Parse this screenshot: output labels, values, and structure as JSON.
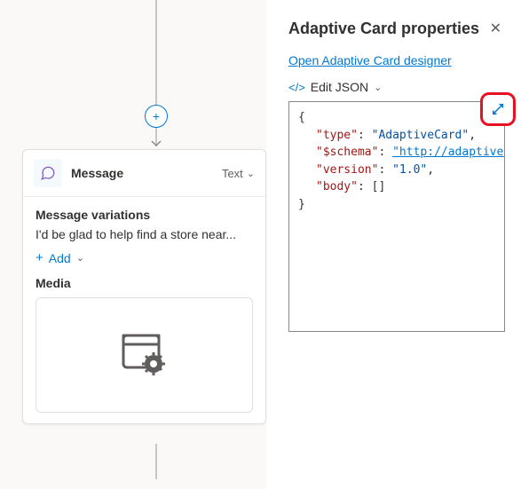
{
  "canvas": {
    "plus_label": "+",
    "node": {
      "title": "Message",
      "type_label": "Text",
      "variations_label": "Message variations",
      "variation_text": "I'd be glad to help find a store near...",
      "add_label": "Add",
      "media_label": "Media"
    }
  },
  "panel": {
    "title": "Adaptive Card properties",
    "designer_link": "Open Adaptive Card designer",
    "edit_json_label": "Edit JSON",
    "json": {
      "type_key": "\"type\"",
      "type_val": "\"AdaptiveCard\"",
      "schema_key": "\"$schema\"",
      "schema_val": "\"http://adaptivecards.i",
      "version_key": "\"version\"",
      "version_val": "\"1.0\"",
      "body_key": "\"body\"",
      "body_val": "[]"
    }
  }
}
